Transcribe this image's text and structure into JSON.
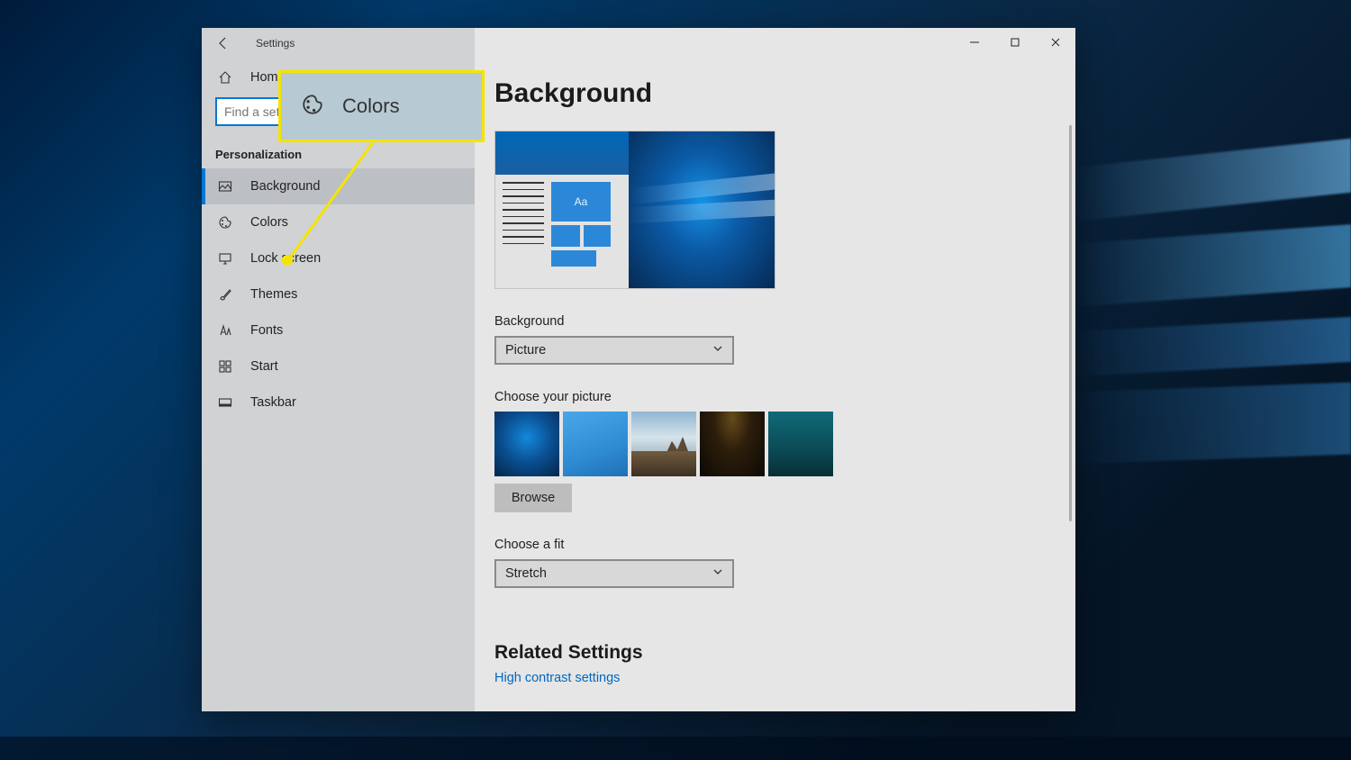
{
  "window": {
    "title": "Settings",
    "home_label": "Home",
    "search_placeholder": "Find a setting",
    "category": "Personalization"
  },
  "sidebar": {
    "items": [
      {
        "label": "Background"
      },
      {
        "label": "Colors"
      },
      {
        "label": "Lock screen"
      },
      {
        "label": "Themes"
      },
      {
        "label": "Fonts"
      },
      {
        "label": "Start"
      },
      {
        "label": "Taskbar"
      }
    ]
  },
  "main": {
    "heading": "Background",
    "preview_sample_text": "Aa",
    "background_label": "Background",
    "background_value": "Picture",
    "choose_picture_label": "Choose your picture",
    "browse_label": "Browse",
    "fit_label": "Choose a fit",
    "fit_value": "Stretch",
    "related_heading": "Related Settings",
    "high_contrast_link": "High contrast settings"
  },
  "callout": {
    "label": "Colors"
  }
}
